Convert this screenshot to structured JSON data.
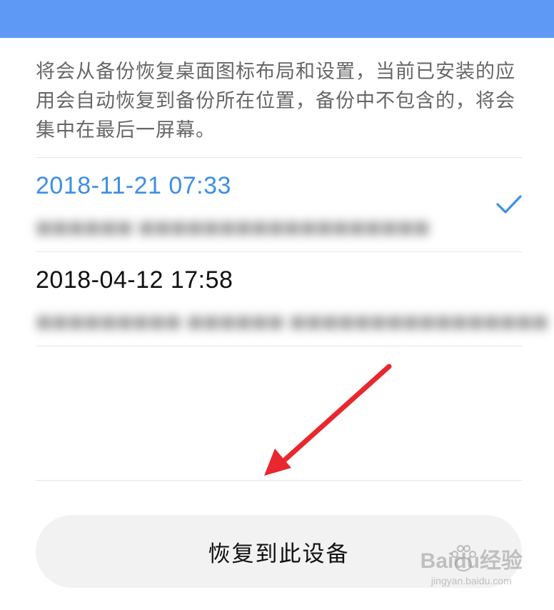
{
  "description": "将会从备份恢复桌面图标布局和设置，当前已安装的应用会自动恢复到备份所在位置，备份中不包含的，将会集中在最后一屏幕。",
  "backups": [
    {
      "date": "2018-11-21 07:33",
      "selected": true
    },
    {
      "date": "2018-04-12 17:58",
      "selected": false
    }
  ],
  "restore_button_label": "恢复到此设备",
  "watermark": {
    "main": "Baidu经验",
    "url": "jingyan.baidu.com"
  },
  "colors": {
    "topbar": "#5e9af5",
    "selected": "#3d8ee6",
    "arrow": "#e8282e",
    "button_bg": "#f2f2f2"
  },
  "icons": {
    "selected_check": "checkmark-icon",
    "annotation": "red-arrow"
  }
}
